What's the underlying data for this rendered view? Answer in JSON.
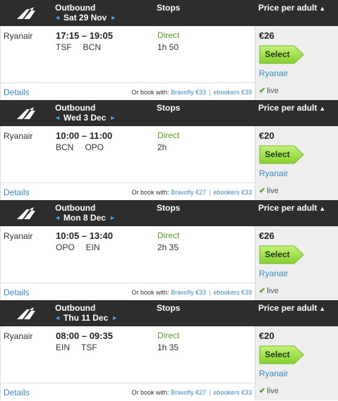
{
  "labels": {
    "outbound": "Outbound",
    "stops": "Stops",
    "price_per_adult": "Price per adult",
    "sort_arrow": "▲",
    "prev_arrow": "◄",
    "next_arrow": "►",
    "select": "Select",
    "details": "Details",
    "or_book_with": "Or book with:",
    "live": "live",
    "separator": "|"
  },
  "colors": {
    "header_bg": "#2d2d2d",
    "select_button": "#9be04a",
    "link": "#3a8ac0",
    "direct": "#5b9a26"
  },
  "flights": [
    {
      "date": "Sat 29 Nov",
      "airline": "Ryanair",
      "times": "17:15 – 19:05",
      "from": "TSF",
      "to": "BCN",
      "stops": "Direct",
      "duration": "1h 50",
      "price": "€26",
      "seller": "Ryanair",
      "alt1": "Bravofly €33",
      "alt2": "ebookers €39"
    },
    {
      "date": "Wed 3 Dec",
      "airline": "Ryanair",
      "times": "10:00 – 11:00",
      "from": "BCN",
      "to": "OPO",
      "stops": "Direct",
      "duration": "2h",
      "price": "€20",
      "seller": "Ryanair",
      "alt1": "Bravofly €27",
      "alt2": "ebookers €33"
    },
    {
      "date": "Mon 8 Dec",
      "airline": "Ryanair",
      "times": "10:05 – 13:40",
      "from": "OPO",
      "to": "EIN",
      "stops": "Direct",
      "duration": "2h 35",
      "price": "€26",
      "seller": "Ryanair",
      "alt1": "Bravofly €33",
      "alt2": "ebookers €39"
    },
    {
      "date": "Thu 11 Dec",
      "airline": "Ryanair",
      "times": "08:00 – 09:35",
      "from": "EIN",
      "to": "TSF",
      "stops": "Direct",
      "duration": "1h 35",
      "price": "€20",
      "seller": "Ryanair",
      "alt1": "Bravofly €27",
      "alt2": "ebookers €33"
    }
  ]
}
